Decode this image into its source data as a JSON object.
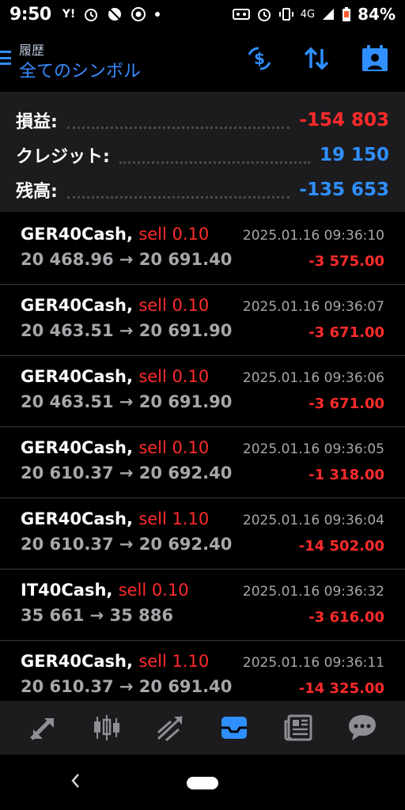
{
  "status_bar": {
    "time": "9:50",
    "battery_percent": "84%",
    "network": "4G"
  },
  "header": {
    "subtitle": "履歴",
    "title": "全てのシンボル"
  },
  "summary": {
    "profit_label": "損益:",
    "profit_value": "-154 803",
    "credit_label": "クレジット:",
    "credit_value": "19 150",
    "balance_label": "残高:",
    "balance_value": "-135 653"
  },
  "trades": [
    {
      "symbol": "GER40Cash,",
      "side": "sell 0.10",
      "prices": "20 468.96 → 20 691.40",
      "time": "2025.01.16 09:36:10",
      "profit": "-3 575.00"
    },
    {
      "symbol": "GER40Cash,",
      "side": "sell 0.10",
      "prices": "20 463.51 → 20 691.90",
      "time": "2025.01.16 09:36:07",
      "profit": "-3 671.00"
    },
    {
      "symbol": "GER40Cash,",
      "side": "sell 0.10",
      "prices": "20 463.51 → 20 691.90",
      "time": "2025.01.16 09:36:06",
      "profit": "-3 671.00"
    },
    {
      "symbol": "GER40Cash,",
      "side": "sell 0.10",
      "prices": "20 610.37 → 20 692.40",
      "time": "2025.01.16 09:36:05",
      "profit": "-1 318.00"
    },
    {
      "symbol": "GER40Cash,",
      "side": "sell 1.10",
      "prices": "20 610.37 → 20 692.40",
      "time": "2025.01.16 09:36:04",
      "profit": "-14 502.00"
    },
    {
      "symbol": "IT40Cash,",
      "side": "sell 0.10",
      "prices": "35 661 → 35 886",
      "time": "2025.01.16 09:36:32",
      "profit": "-3 616.00"
    },
    {
      "symbol": "GER40Cash,",
      "side": "sell 1.10",
      "prices": "20 610.37 → 20 691.40",
      "time": "2025.01.16 09:36:11",
      "profit": "-14 325.00"
    }
  ],
  "tabs": [
    {
      "icon": "quotes-icon"
    },
    {
      "icon": "chart-icon"
    },
    {
      "icon": "trade-icon"
    },
    {
      "icon": "history-icon",
      "active": true
    },
    {
      "icon": "news-icon"
    },
    {
      "icon": "chat-icon"
    }
  ],
  "colors": {
    "accent": "#2f8fff",
    "loss": "#ff2b2b",
    "panel": "#1c1c1e",
    "muted": "#a7a7ab"
  }
}
